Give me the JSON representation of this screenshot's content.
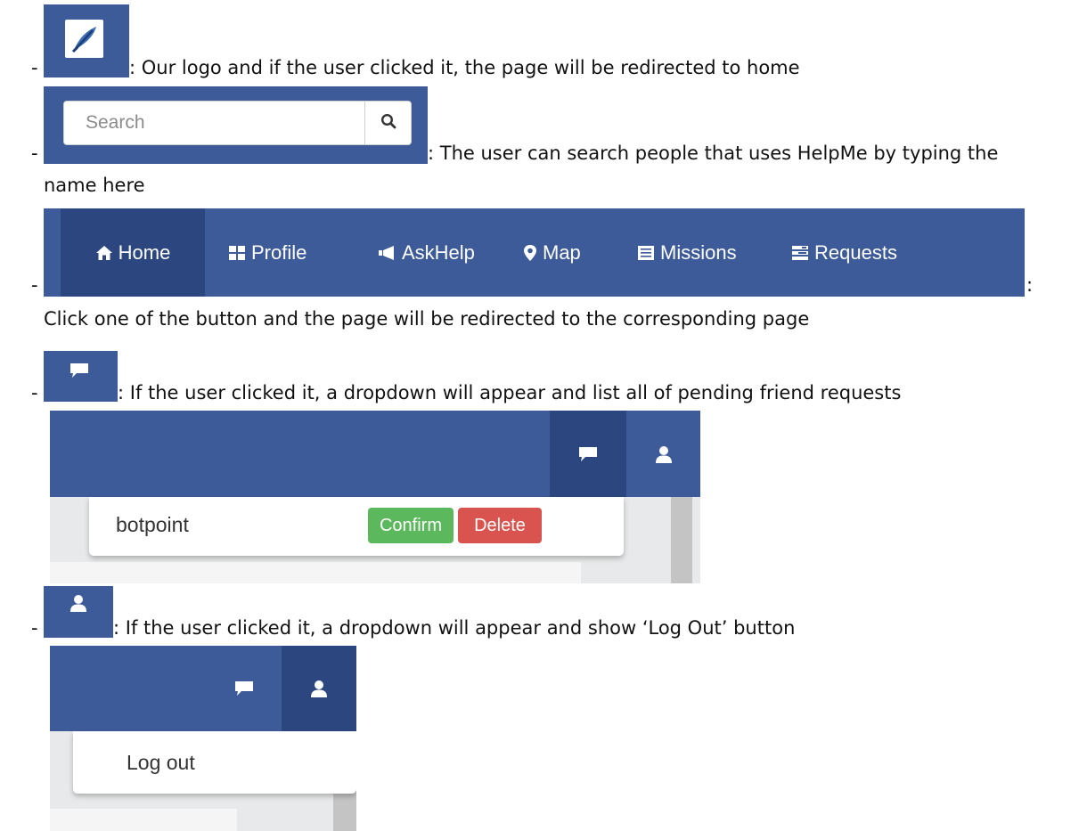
{
  "colors": {
    "navbar": "#3d5a99",
    "active": "#2c477f",
    "confirm": "#5cb85c",
    "delete": "#d9534f"
  },
  "bullet": "-",
  "logo": {
    "icon": "feather-logo-icon",
    "description": ": Our logo and if the user clicked it, the page will be redirected to home"
  },
  "search": {
    "placeholder": "Search",
    "icon": "search-icon",
    "description_line1": ": The user can search people that uses HelpMe by typing the",
    "description_line2": "name here"
  },
  "nav": {
    "items": [
      {
        "label": "Home",
        "icon": "home-icon",
        "active": true
      },
      {
        "label": "Profile",
        "icon": "grid-icon",
        "active": false
      },
      {
        "label": "AskHelp",
        "icon": "megaphone-icon",
        "active": false
      },
      {
        "label": "Map",
        "icon": "map-marker-icon",
        "active": false
      },
      {
        "label": "Missions",
        "icon": "list-icon",
        "active": false
      },
      {
        "label": "Requests",
        "icon": "tasks-icon",
        "active": false
      }
    ],
    "colon": ":",
    "description": "Click one of the button and the page will be redirected to the corresponding page"
  },
  "friend_requests": {
    "icon": "chat-icon",
    "description": ": If the user clicked it, a dropdown will appear and list all of pending friend requests",
    "items": [
      {
        "name": "botpoint",
        "confirm_label": "Confirm",
        "delete_label": "Delete"
      }
    ]
  },
  "user_menu": {
    "icon": "user-icon",
    "description": ": If the user clicked it, a dropdown will appear and show ‘Log Out’ button",
    "items": [
      {
        "label": "Log out"
      }
    ]
  }
}
